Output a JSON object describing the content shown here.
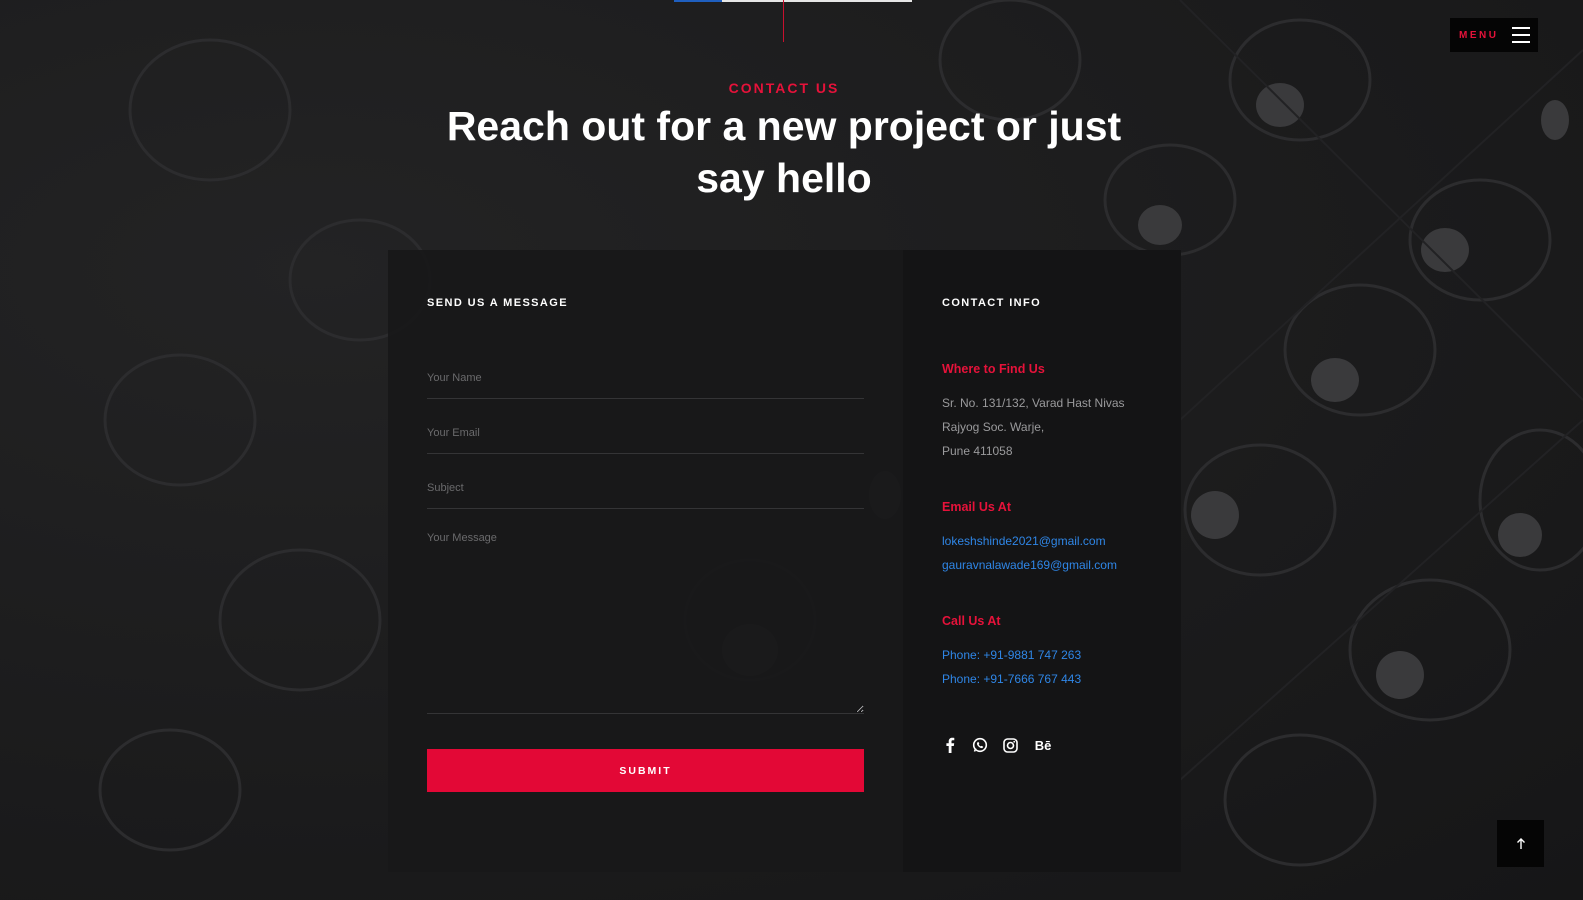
{
  "header": {
    "menu_label": "MENU",
    "progress_fraction": 0.2
  },
  "hero": {
    "eyebrow": "CONTACT US",
    "headline": "Reach out for a new project or just say hello"
  },
  "form": {
    "title": "SEND US A MESSAGE",
    "name_placeholder": "Your Name",
    "email_placeholder": "Your Email",
    "subject_placeholder": "Subject",
    "message_placeholder": "Your Message",
    "name_value": "",
    "email_value": "",
    "subject_value": "",
    "message_value": "",
    "submit_label": "SUBMIT"
  },
  "info": {
    "title": "CONTACT INFO",
    "find_heading": "Where to Find Us",
    "address_lines": [
      "Sr. No. 131/132, Varad Hast Nivas",
      "Rajyog Soc. Warje,",
      "Pune 411058"
    ],
    "email_heading": "Email Us At",
    "emails": [
      "lokeshshinde2021@gmail.com",
      "gauravnalawade169@gmail.com"
    ],
    "call_heading": "Call Us At",
    "phones": [
      "Phone: +91-9881 747 263",
      "Phone: +91-7666 767 443"
    ],
    "social_icons": [
      "facebook-icon",
      "whatsapp-icon",
      "instagram-icon",
      "behance-icon"
    ],
    "behance_text": "Bē"
  },
  "colors": {
    "accent": "#e30836",
    "link": "#2f86e6",
    "background": "#1a1a1b"
  }
}
